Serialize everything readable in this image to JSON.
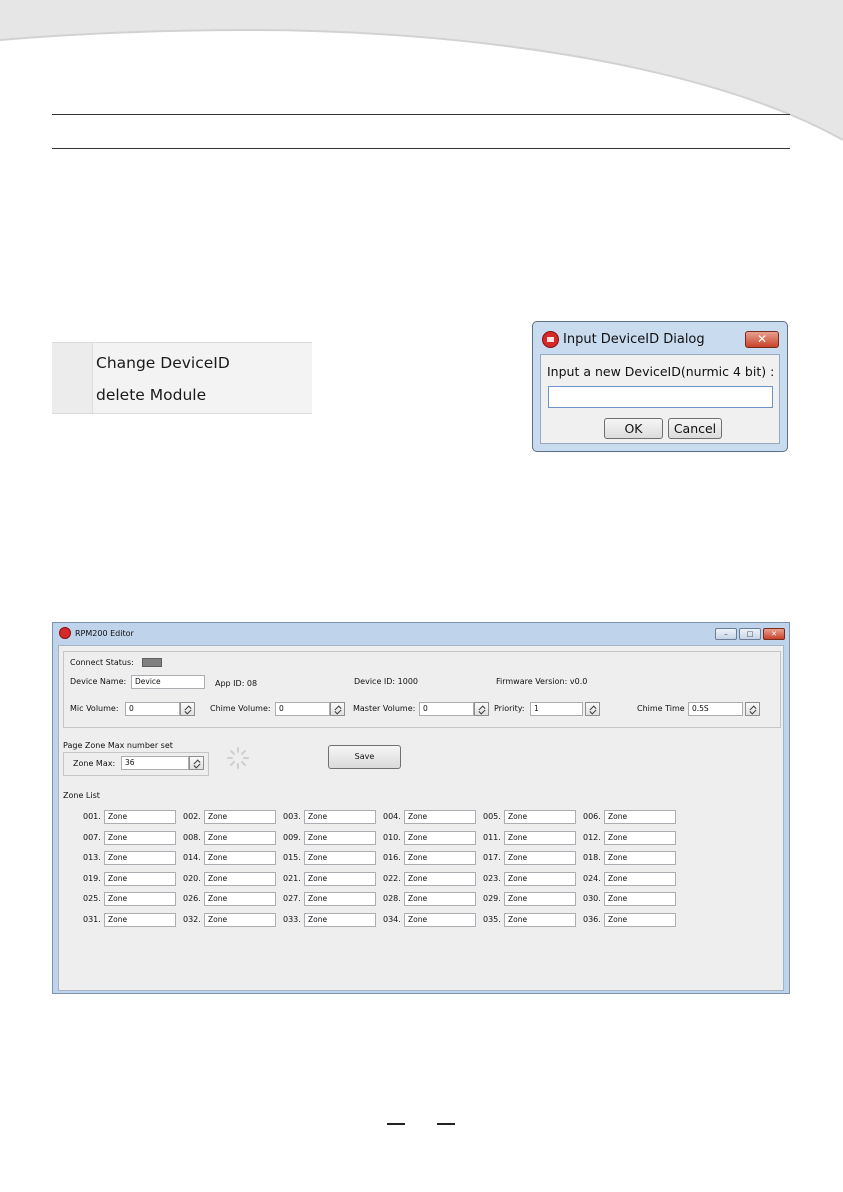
{
  "context_menu": {
    "items": [
      "Change DeviceID",
      "delete Module"
    ]
  },
  "input_dialog": {
    "title": "Input DeviceID Dialog",
    "close_label": "✕",
    "prompt": "Input a new DeviceID(nurmic 4 bit) :",
    "input_value": "",
    "ok_label": "OK",
    "cancel_label": "Cancel"
  },
  "editor": {
    "title": "RPM200 Editor",
    "connect_status_label": "Connect Status:",
    "device_name_label": "Device Name:",
    "device_name_value": "Device",
    "app_id": "App ID: 08",
    "device_id": "Device ID: 1000",
    "firmware_version": "Firmware Version: v0.0",
    "mic_volume_label": "Mic Volume:",
    "mic_volume_value": "0",
    "chime_volume_label": "Chime Volume:",
    "chime_volume_value": "0",
    "master_volume_label": "Master Volume:",
    "master_volume_value": "0",
    "priority_label": "Priority:",
    "priority_value": "1",
    "chime_time_label": "Chime Time",
    "chime_time_value": "0.5S",
    "page_zone_group_label": "Page Zone Max number set",
    "zone_max_label": "Zone Max:",
    "zone_max_value": "36",
    "save_label": "Save",
    "zone_list_label": "Zone List",
    "zones": [
      {
        "num": "001.",
        "name": "Zone"
      },
      {
        "num": "002.",
        "name": "Zone"
      },
      {
        "num": "003.",
        "name": "Zone"
      },
      {
        "num": "004.",
        "name": "Zone"
      },
      {
        "num": "005.",
        "name": "Zone"
      },
      {
        "num": "006.",
        "name": "Zone"
      },
      {
        "num": "007.",
        "name": "Zone"
      },
      {
        "num": "008.",
        "name": "Zone"
      },
      {
        "num": "009.",
        "name": "Zone"
      },
      {
        "num": "010.",
        "name": "Zone"
      },
      {
        "num": "011.",
        "name": "Zone"
      },
      {
        "num": "012.",
        "name": "Zone"
      },
      {
        "num": "013.",
        "name": "Zone"
      },
      {
        "num": "014.",
        "name": "Zone"
      },
      {
        "num": "015.",
        "name": "Zone"
      },
      {
        "num": "016.",
        "name": "Zone"
      },
      {
        "num": "017.",
        "name": "Zone"
      },
      {
        "num": "018.",
        "name": "Zone"
      },
      {
        "num": "019.",
        "name": "Zone"
      },
      {
        "num": "020.",
        "name": "Zone"
      },
      {
        "num": "021.",
        "name": "Zone"
      },
      {
        "num": "022.",
        "name": "Zone"
      },
      {
        "num": "023.",
        "name": "Zone"
      },
      {
        "num": "024.",
        "name": "Zone"
      },
      {
        "num": "025.",
        "name": "Zone"
      },
      {
        "num": "026.",
        "name": "Zone"
      },
      {
        "num": "027.",
        "name": "Zone"
      },
      {
        "num": "028.",
        "name": "Zone"
      },
      {
        "num": "029.",
        "name": "Zone"
      },
      {
        "num": "030.",
        "name": "Zone"
      },
      {
        "num": "031.",
        "name": "Zone"
      },
      {
        "num": "032.",
        "name": "Zone"
      },
      {
        "num": "033.",
        "name": "Zone"
      },
      {
        "num": "034.",
        "name": "Zone"
      },
      {
        "num": "035.",
        "name": "Zone"
      },
      {
        "num": "036.",
        "name": "Zone"
      }
    ]
  },
  "colors": {
    "window_frame": "#bfd3ea",
    "close_button": "#c8432a",
    "status_led": "#808080"
  }
}
